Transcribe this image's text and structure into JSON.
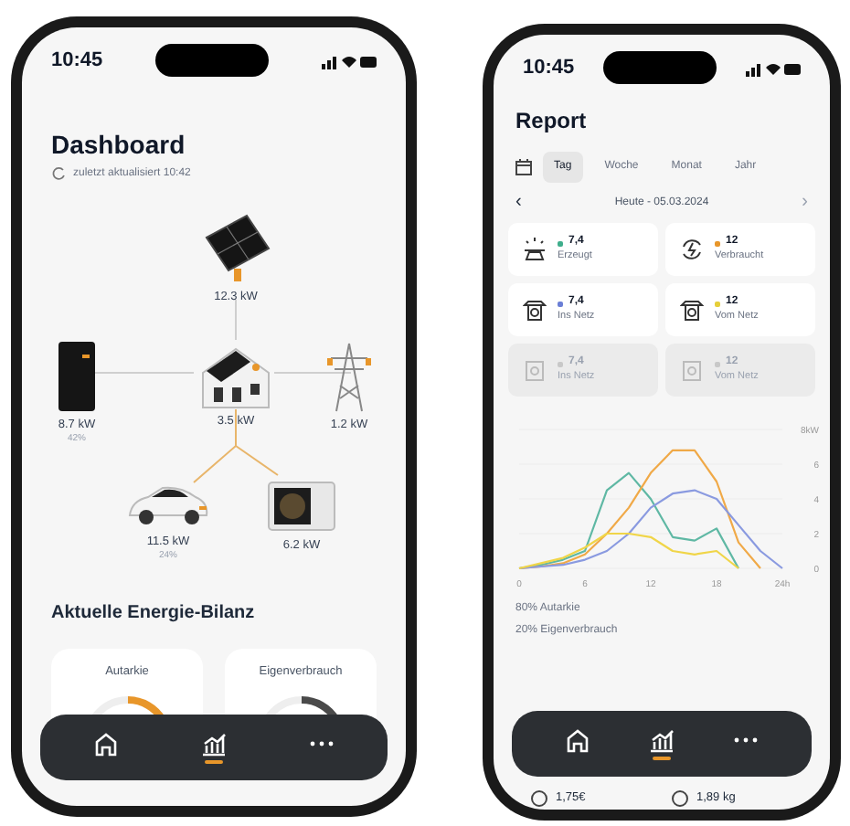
{
  "dashboard": {
    "status_bar": {
      "time": "10:45"
    },
    "title": "Dashboard",
    "updated": "zuletzt aktualisiert 10:42",
    "nodes": [
      {
        "kind": "solar",
        "value": "12.3 kW"
      },
      {
        "kind": "battery",
        "value": "8.7 kW",
        "sub": "42%"
      },
      {
        "kind": "house",
        "value": "3.5 kW"
      },
      {
        "kind": "grid",
        "value": "1.2 kW"
      },
      {
        "kind": "car",
        "value": "11.5 kW",
        "sub": "24%"
      },
      {
        "kind": "heatpump",
        "value": "6.2 kW"
      }
    ],
    "section_title": "Aktuelle Energie-Bilanz",
    "gauges": [
      {
        "label": "Autarkie",
        "color": "#e8962a"
      },
      {
        "label": "Eigenverbrauch",
        "color": "#4a4a4a"
      }
    ],
    "nav": [
      {
        "kind": "home",
        "selected": false
      },
      {
        "kind": "chart",
        "selected": true
      },
      {
        "kind": "more",
        "selected": false
      }
    ]
  },
  "report": {
    "status_bar": {
      "time": "10:45"
    },
    "title": "Report",
    "tabs": [
      {
        "label": "Tag",
        "selected": true
      },
      {
        "label": "Woche",
        "selected": false
      },
      {
        "label": "Monat",
        "selected": false
      },
      {
        "label": "Jahr",
        "selected": false
      }
    ],
    "date_nav": {
      "prev": "‹",
      "label": "Heute - 05.03.2024",
      "next": "›"
    },
    "cards": [
      {
        "value": "7,4",
        "label": "Erzeugt",
        "color": "#3fae8c",
        "disabled": false
      },
      {
        "value": "12",
        "label": "Verbraucht",
        "color": "#e8962a",
        "disabled": false
      },
      {
        "value": "7,4",
        "label": "Ins Netz",
        "color": "#6b7fd6",
        "disabled": false
      },
      {
        "value": "12",
        "label": "Vom Netz",
        "color": "#e6cf3a",
        "disabled": false
      },
      {
        "value": "7,4",
        "label": "Ins Netz",
        "color": "#c8c8c8",
        "disabled": true
      },
      {
        "value": "12",
        "label": "Vom Netz",
        "color": "#c8c8c8",
        "disabled": true
      }
    ],
    "chart_data": {
      "type": "line",
      "x": [
        0,
        2,
        4,
        6,
        8,
        10,
        12,
        14,
        16,
        18,
        20,
        22,
        24
      ],
      "series": [
        {
          "color": "#5fb8a4",
          "values": [
            0,
            0.2,
            0.5,
            1,
            4.5,
            5.5,
            4,
            1.8,
            1.6,
            2.3,
            0,
            null,
            null
          ]
        },
        {
          "color": "#f0a947",
          "values": [
            0,
            0.1,
            0.3,
            0.8,
            2,
            3.5,
            5.5,
            6.8,
            6.8,
            5,
            1.5,
            0,
            null
          ]
        },
        {
          "color": "#8a9ae0",
          "values": [
            0,
            0.1,
            0.2,
            0.5,
            1,
            2,
            3.5,
            4.3,
            4.5,
            4,
            2.5,
            1,
            0
          ]
        },
        {
          "color": "#f0d548",
          "values": [
            0,
            0.3,
            0.6,
            1.2,
            2,
            2,
            1.8,
            1,
            0.8,
            1,
            0,
            null,
            null
          ]
        }
      ],
      "xlim": [
        0,
        24
      ],
      "ylim": [
        0,
        8
      ],
      "xticks": [
        0,
        6,
        12,
        18,
        {
          "value": 24,
          "label": "24h"
        }
      ],
      "yticks": [
        0,
        2,
        4,
        6,
        {
          "value": 8,
          "label": "8kW"
        }
      ]
    },
    "summary": [
      "80% Autarkie",
      "20% Eigenverbrauch"
    ],
    "nav": [
      {
        "kind": "home",
        "selected": false
      },
      {
        "kind": "chart",
        "selected": true
      },
      {
        "kind": "more",
        "selected": false
      }
    ],
    "bottom_values": [
      "1,75€",
      "1,89 kg"
    ]
  }
}
